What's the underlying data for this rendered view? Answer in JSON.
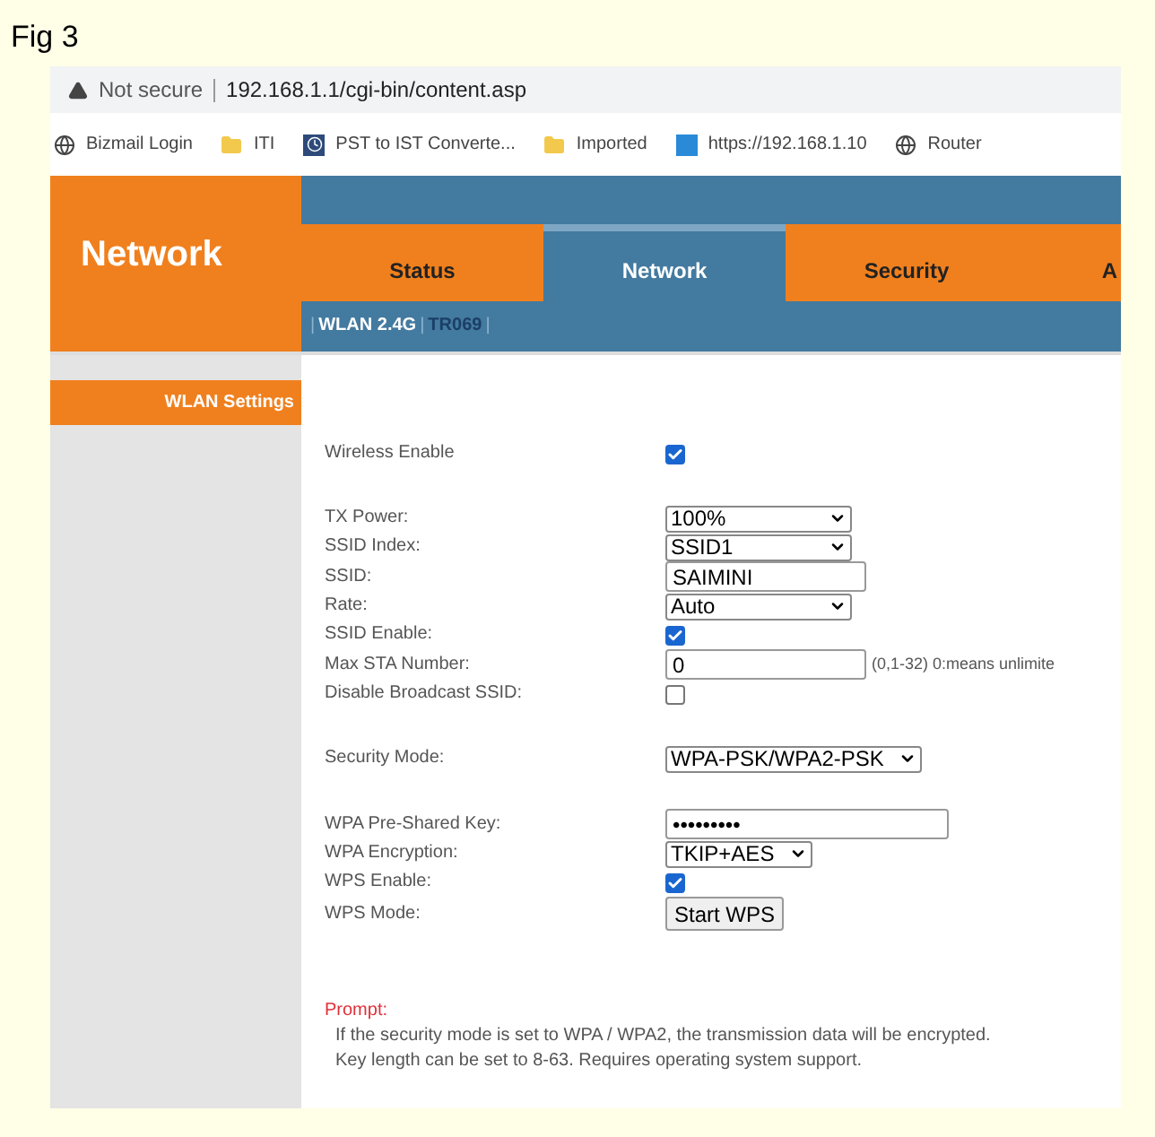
{
  "figure_label": "Fig 3",
  "browser": {
    "security": "Not secure",
    "url": "192.168.1.1/cgi-bin/content.asp",
    "bookmarks": [
      {
        "label": "Bizmail Login",
        "kind": "globe"
      },
      {
        "label": "ITI",
        "kind": "folder"
      },
      {
        "label": "PST to IST Converte...",
        "kind": "app"
      },
      {
        "label": "Imported",
        "kind": "folder"
      },
      {
        "label": "https://192.168.1.10",
        "kind": "link"
      },
      {
        "label": "Router",
        "kind": "globe"
      }
    ]
  },
  "header": {
    "logo": "Network",
    "tabs": [
      {
        "label": "Status",
        "selected": false
      },
      {
        "label": "Network",
        "selected": true
      },
      {
        "label": "Security",
        "selected": false
      },
      {
        "label": "A",
        "selected": false
      }
    ],
    "subnav_separator": "|",
    "subnav": [
      {
        "label": "WLAN 2.4G",
        "selected": true
      },
      {
        "label": "TR069",
        "selected": false
      }
    ]
  },
  "sidebar": {
    "items": [
      {
        "label": "WLAN Settings",
        "selected": true
      }
    ]
  },
  "form_groups": [
    [
      {
        "label": "Wireless Enable",
        "kind": "checkbox",
        "checked": true
      }
    ],
    [
      {
        "label": "TX Power:",
        "kind": "select",
        "value": "100%"
      },
      {
        "label": "SSID Index:",
        "kind": "select",
        "value": "SSID1"
      },
      {
        "label": "SSID:",
        "kind": "text",
        "value": "SAIMINI"
      },
      {
        "label": "Rate:",
        "kind": "select",
        "value": "Auto"
      },
      {
        "label": "SSID Enable:",
        "kind": "checkbox",
        "checked": true
      },
      {
        "label": "Max STA Number:",
        "kind": "text",
        "value": "0",
        "hint": "(0,1-32) 0:means unlimite"
      },
      {
        "label": "Disable Broadcast SSID:",
        "kind": "checkbox",
        "checked": false
      }
    ],
    [
      {
        "label": "Security Mode:",
        "kind": "select",
        "value": "WPA-PSK/WPA2-PSK"
      }
    ],
    [
      {
        "label": "WPA Pre-Shared Key:",
        "kind": "password",
        "value": "•••••••••"
      },
      {
        "label": "WPA Encryption:",
        "kind": "select",
        "value": "TKIP+AES"
      },
      {
        "label": "WPS Enable:",
        "kind": "checkbox",
        "checked": true
      },
      {
        "label": "WPS Mode:",
        "kind": "button",
        "value": "Start WPS"
      }
    ]
  ],
  "prompt": {
    "title": "Prompt:",
    "lines": [
      "If the security mode is set to WPA / WPA2, the transmission data will be encrypted.",
      "Key length can be set to 8-63. Requires operating system support."
    ]
  }
}
